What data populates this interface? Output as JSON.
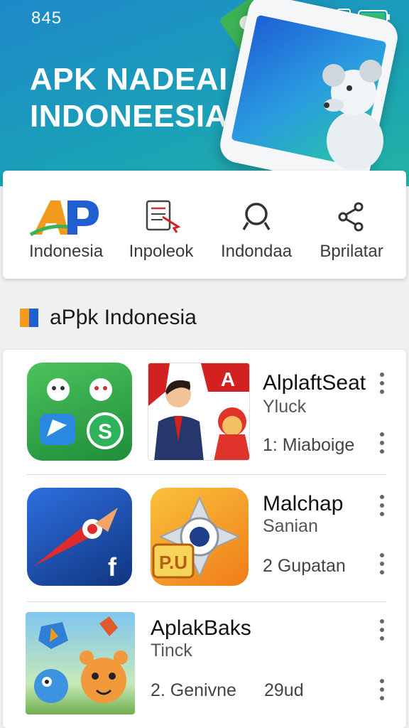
{
  "status": {
    "time": "845"
  },
  "hero": {
    "title_line1": "APK NADEAI",
    "title_line2": "INDONEESIA"
  },
  "nav": {
    "items": [
      {
        "label": "Indonesia",
        "icon": "ap-logo-icon"
      },
      {
        "label": "Inpoleok",
        "icon": "document-icon"
      },
      {
        "label": "Indondaa",
        "icon": "search-icon"
      },
      {
        "label": "Bprilatar",
        "icon": "share-icon"
      }
    ]
  },
  "section": {
    "title": "aPþk Indonesia"
  },
  "apps": [
    {
      "name": "AlplaftSeat",
      "sub": "Yluck",
      "meta": "1: Miaboige",
      "extra": ""
    },
    {
      "name": "Malchap",
      "sub": "Sanian",
      "meta": "2 Gupatan",
      "extra": ""
    },
    {
      "name": "AplakBaks",
      "sub": "Tinck",
      "meta": "2. Genivne",
      "extra": "29ud"
    }
  ],
  "icon_text": {
    "pu_badge": "P.U",
    "a_badge": "A",
    "fb_letter": "f",
    "s_letter": "S"
  },
  "colors": {
    "hero_start": "#1e88c9",
    "hero_end": "#23b3a4",
    "accent_blue": "#1f5fd0",
    "accent_orange": "#f29a1b"
  }
}
